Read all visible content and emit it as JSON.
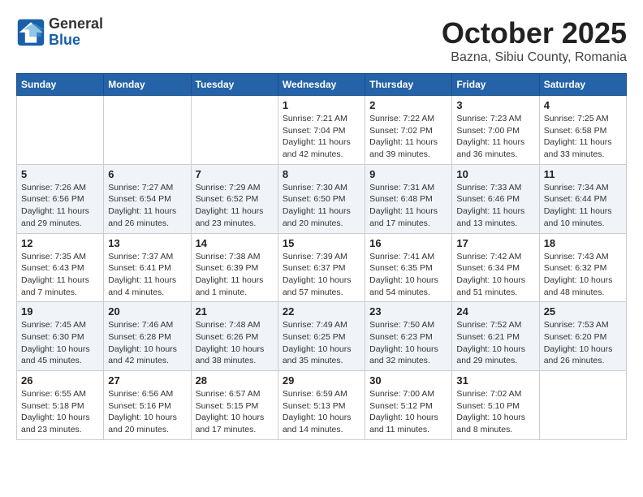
{
  "logo": {
    "general": "General",
    "blue": "Blue"
  },
  "title": "October 2025",
  "subtitle": "Bazna, Sibiu County, Romania",
  "weekdays": [
    "Sunday",
    "Monday",
    "Tuesday",
    "Wednesday",
    "Thursday",
    "Friday",
    "Saturday"
  ],
  "weeks": [
    [
      {
        "day": "",
        "info": ""
      },
      {
        "day": "",
        "info": ""
      },
      {
        "day": "",
        "info": ""
      },
      {
        "day": "1",
        "info": "Sunrise: 7:21 AM\nSunset: 7:04 PM\nDaylight: 11 hours and 42 minutes."
      },
      {
        "day": "2",
        "info": "Sunrise: 7:22 AM\nSunset: 7:02 PM\nDaylight: 11 hours and 39 minutes."
      },
      {
        "day": "3",
        "info": "Sunrise: 7:23 AM\nSunset: 7:00 PM\nDaylight: 11 hours and 36 minutes."
      },
      {
        "day": "4",
        "info": "Sunrise: 7:25 AM\nSunset: 6:58 PM\nDaylight: 11 hours and 33 minutes."
      }
    ],
    [
      {
        "day": "5",
        "info": "Sunrise: 7:26 AM\nSunset: 6:56 PM\nDaylight: 11 hours and 29 minutes."
      },
      {
        "day": "6",
        "info": "Sunrise: 7:27 AM\nSunset: 6:54 PM\nDaylight: 11 hours and 26 minutes."
      },
      {
        "day": "7",
        "info": "Sunrise: 7:29 AM\nSunset: 6:52 PM\nDaylight: 11 hours and 23 minutes."
      },
      {
        "day": "8",
        "info": "Sunrise: 7:30 AM\nSunset: 6:50 PM\nDaylight: 11 hours and 20 minutes."
      },
      {
        "day": "9",
        "info": "Sunrise: 7:31 AM\nSunset: 6:48 PM\nDaylight: 11 hours and 17 minutes."
      },
      {
        "day": "10",
        "info": "Sunrise: 7:33 AM\nSunset: 6:46 PM\nDaylight: 11 hours and 13 minutes."
      },
      {
        "day": "11",
        "info": "Sunrise: 7:34 AM\nSunset: 6:44 PM\nDaylight: 11 hours and 10 minutes."
      }
    ],
    [
      {
        "day": "12",
        "info": "Sunrise: 7:35 AM\nSunset: 6:43 PM\nDaylight: 11 hours and 7 minutes."
      },
      {
        "day": "13",
        "info": "Sunrise: 7:37 AM\nSunset: 6:41 PM\nDaylight: 11 hours and 4 minutes."
      },
      {
        "day": "14",
        "info": "Sunrise: 7:38 AM\nSunset: 6:39 PM\nDaylight: 11 hours and 1 minute."
      },
      {
        "day": "15",
        "info": "Sunrise: 7:39 AM\nSunset: 6:37 PM\nDaylight: 10 hours and 57 minutes."
      },
      {
        "day": "16",
        "info": "Sunrise: 7:41 AM\nSunset: 6:35 PM\nDaylight: 10 hours and 54 minutes."
      },
      {
        "day": "17",
        "info": "Sunrise: 7:42 AM\nSunset: 6:34 PM\nDaylight: 10 hours and 51 minutes."
      },
      {
        "day": "18",
        "info": "Sunrise: 7:43 AM\nSunset: 6:32 PM\nDaylight: 10 hours and 48 minutes."
      }
    ],
    [
      {
        "day": "19",
        "info": "Sunrise: 7:45 AM\nSunset: 6:30 PM\nDaylight: 10 hours and 45 minutes."
      },
      {
        "day": "20",
        "info": "Sunrise: 7:46 AM\nSunset: 6:28 PM\nDaylight: 10 hours and 42 minutes."
      },
      {
        "day": "21",
        "info": "Sunrise: 7:48 AM\nSunset: 6:26 PM\nDaylight: 10 hours and 38 minutes."
      },
      {
        "day": "22",
        "info": "Sunrise: 7:49 AM\nSunset: 6:25 PM\nDaylight: 10 hours and 35 minutes."
      },
      {
        "day": "23",
        "info": "Sunrise: 7:50 AM\nSunset: 6:23 PM\nDaylight: 10 hours and 32 minutes."
      },
      {
        "day": "24",
        "info": "Sunrise: 7:52 AM\nSunset: 6:21 PM\nDaylight: 10 hours and 29 minutes."
      },
      {
        "day": "25",
        "info": "Sunrise: 7:53 AM\nSunset: 6:20 PM\nDaylight: 10 hours and 26 minutes."
      }
    ],
    [
      {
        "day": "26",
        "info": "Sunrise: 6:55 AM\nSunset: 5:18 PM\nDaylight: 10 hours and 23 minutes."
      },
      {
        "day": "27",
        "info": "Sunrise: 6:56 AM\nSunset: 5:16 PM\nDaylight: 10 hours and 20 minutes."
      },
      {
        "day": "28",
        "info": "Sunrise: 6:57 AM\nSunset: 5:15 PM\nDaylight: 10 hours and 17 minutes."
      },
      {
        "day": "29",
        "info": "Sunrise: 6:59 AM\nSunset: 5:13 PM\nDaylight: 10 hours and 14 minutes."
      },
      {
        "day": "30",
        "info": "Sunrise: 7:00 AM\nSunset: 5:12 PM\nDaylight: 10 hours and 11 minutes."
      },
      {
        "day": "31",
        "info": "Sunrise: 7:02 AM\nSunset: 5:10 PM\nDaylight: 10 hours and 8 minutes."
      },
      {
        "day": "",
        "info": ""
      }
    ]
  ]
}
